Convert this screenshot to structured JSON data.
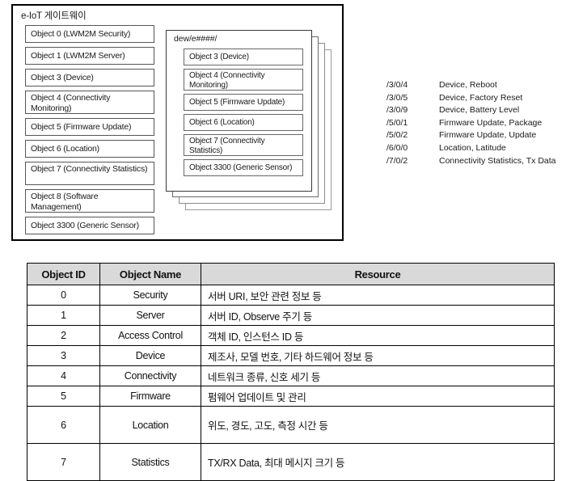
{
  "diagram": {
    "title": "e-IoT 게이트웨이",
    "left_objects": [
      {
        "label": "Object 0 (LWM2M  Security)",
        "lines": 1
      },
      {
        "label": "Object 1 (LWM2M  Server)",
        "lines": 1
      },
      {
        "label": "Object 3 (Device)",
        "lines": 1
      },
      {
        "label": "Object 4 (Connectivity Monitoring)",
        "lines": 2
      },
      {
        "label": "Object 5 (Firmware Update)",
        "lines": 1
      },
      {
        "label": "Object 6 (Location)",
        "lines": 1
      },
      {
        "label": "Object 7 (Connectivity Statistics)",
        "lines": 2
      },
      {
        "label": "Object 8 (Software Management)",
        "lines": 2
      },
      {
        "label": "Object 3300 (Generic Sensor)",
        "lines": 1
      }
    ],
    "stack": {
      "panel_title": "dew/e####/",
      "layers": 4,
      "objects": [
        {
          "label": "Object 3 (Device)",
          "lines": 1
        },
        {
          "label": "Object 4 (Connectivity Monitoring)",
          "lines": 2
        },
        {
          "label": "Object 5 (Firmware Update)",
          "lines": 1
        },
        {
          "label": "Object 6 (Location)",
          "lines": 1
        },
        {
          "label": "Object 7 (Connectivity Statistics)",
          "lines": 2
        },
        {
          "label": "Object 3300 (Generic Sensor)",
          "lines": 1
        }
      ]
    }
  },
  "path_list": [
    {
      "path": "/3/0/4",
      "description": "Device, Reboot"
    },
    {
      "path": "/3/0/5",
      "description": "Device, Factory Reset"
    },
    {
      "path": "/3/0/9",
      "description": "Device, Battery Level"
    },
    {
      "path": "/5/0/1",
      "description": "Firmware Update, Package"
    },
    {
      "path": "/5/0/2",
      "description": "Firmware Update, Update"
    },
    {
      "path": "/6/0/0",
      "description": "Location, Latitude"
    },
    {
      "path": "/7/0/2",
      "description": "Connectivity Statistics, Tx Data"
    }
  ],
  "table": {
    "headers": [
      "Object ID",
      "Object Name",
      "Resource"
    ],
    "rows": [
      {
        "id": "0",
        "name": "Security",
        "resource": "서버 URI, 보안 관련 정보 등",
        "tall": false
      },
      {
        "id": "1",
        "name": "Server",
        "resource": "서버 ID, Observe 주기 등",
        "tall": false
      },
      {
        "id": "2",
        "name": "Access Control",
        "resource": "객체 ID, 인스턴스 ID 등",
        "tall": false
      },
      {
        "id": "3",
        "name": "Device",
        "resource": "제조사, 모델 번호, 기타 하드웨어 정보 등",
        "tall": false
      },
      {
        "id": "4",
        "name": "Connectivity",
        "resource": "네트워크 종류, 신호 세기 등",
        "tall": false
      },
      {
        "id": "5",
        "name": "Firmware",
        "resource": "펌웨어 업데이트 및 관리",
        "tall": false
      },
      {
        "id": "6",
        "name": "Location",
        "resource": "위도, 경도, 고도, 측정 시간 등",
        "tall": true
      },
      {
        "id": "7",
        "name": "Statistics",
        "resource": "TX/RX Data, 최대 메시지 크기 등",
        "tall": true
      }
    ]
  },
  "colors": {
    "header_fill": "#d9d9d9",
    "border": "#000000",
    "box_border": "#555555"
  }
}
